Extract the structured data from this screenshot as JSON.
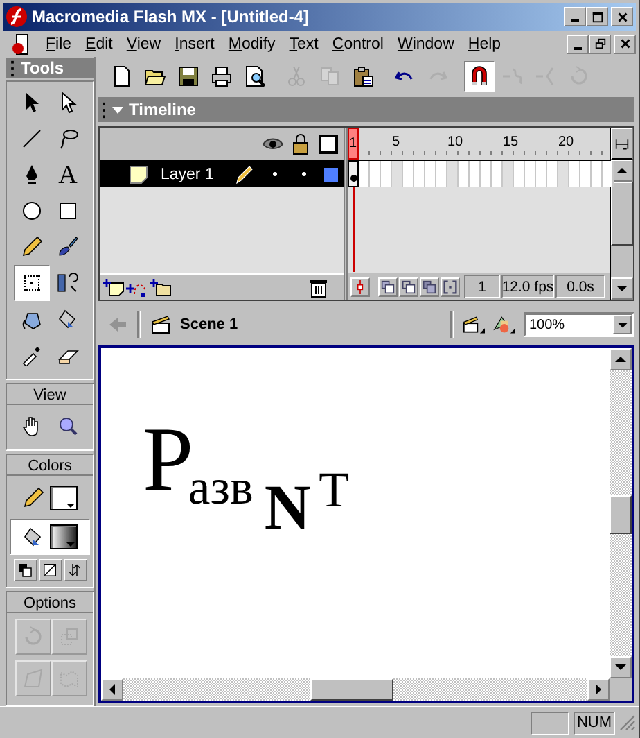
{
  "window": {
    "title": "Macromedia Flash MX - [Untitled-4]"
  },
  "menu": [
    "File",
    "Edit",
    "View",
    "Insert",
    "Modify",
    "Text",
    "Control",
    "Window",
    "Help"
  ],
  "toolbar": [
    {
      "kind": "new",
      "disabled": false,
      "selected": false
    },
    {
      "kind": "open",
      "disabled": false,
      "selected": false
    },
    {
      "kind": "save",
      "disabled": false,
      "selected": false
    },
    {
      "kind": "print",
      "disabled": false,
      "selected": false
    },
    {
      "kind": "preview",
      "disabled": false,
      "selected": false
    },
    {
      "kind": "cut",
      "disabled": true,
      "selected": false
    },
    {
      "kind": "copy",
      "disabled": true,
      "selected": false
    },
    {
      "kind": "paste",
      "disabled": false,
      "selected": false
    },
    {
      "kind": "undo",
      "disabled": false,
      "selected": false
    },
    {
      "kind": "redo",
      "disabled": true,
      "selected": false
    },
    {
      "kind": "snap",
      "disabled": false,
      "selected": true
    },
    {
      "kind": "smooth",
      "disabled": true,
      "selected": false
    },
    {
      "kind": "straighten",
      "disabled": true,
      "selected": false
    },
    {
      "kind": "rotate",
      "disabled": true,
      "selected": false
    }
  ],
  "tools_panel": {
    "title": "Tools",
    "tools": [
      {
        "kind": "arrow",
        "selected": false
      },
      {
        "kind": "subselect",
        "selected": false
      },
      {
        "kind": "line",
        "selected": false
      },
      {
        "kind": "lasso",
        "selected": false
      },
      {
        "kind": "pen",
        "selected": false
      },
      {
        "kind": "text",
        "glyph": "A",
        "selected": false
      },
      {
        "kind": "oval",
        "selected": false
      },
      {
        "kind": "rectangle",
        "selected": false
      },
      {
        "kind": "pencil",
        "selected": false
      },
      {
        "kind": "brush",
        "selected": false
      },
      {
        "kind": "free-transform",
        "selected": true
      },
      {
        "kind": "fill-transform",
        "selected": false
      },
      {
        "kind": "ink-bottle",
        "selected": false
      },
      {
        "kind": "paint-bucket",
        "selected": false
      },
      {
        "kind": "eyedropper",
        "selected": false
      },
      {
        "kind": "eraser",
        "selected": false
      }
    ],
    "view_label": "View",
    "view_tools": [
      {
        "kind": "hand",
        "selected": false
      },
      {
        "kind": "zoom",
        "selected": false
      }
    ],
    "colors_label": "Colors",
    "colors": [
      {
        "kind": "stroke",
        "selected": false
      },
      {
        "kind": "fill",
        "selected": true
      }
    ],
    "color_buttons": [
      {
        "kind": "black-white"
      },
      {
        "kind": "no-color"
      },
      {
        "kind": "swap"
      }
    ],
    "options_label": "Options",
    "options": [
      {
        "kind": "rotate",
        "disabled": true
      },
      {
        "kind": "scale",
        "disabled": true
      },
      {
        "kind": "distort",
        "disabled": true
      },
      {
        "kind": "envelope",
        "disabled": true
      }
    ]
  },
  "timeline": {
    "title": "Timeline",
    "expanded": true,
    "frame_numbers": [
      "1",
      "5",
      "10",
      "15",
      "20"
    ],
    "layers": [
      {
        "name": "Layer 1",
        "selected": true,
        "color": "#4f7fff"
      }
    ],
    "current_frame": "1",
    "frame_rate": "12.0 fps",
    "elapsed_time": "0.0s"
  },
  "scene_bar": {
    "scene": "Scene 1",
    "zoom": "100%"
  },
  "stage": {
    "text": [
      {
        "kind": "large",
        "text": "Р"
      },
      {
        "kind": "small",
        "text": "азв"
      },
      {
        "kind": "bold",
        "text": "N"
      },
      {
        "kind": "raised",
        "text": "Т"
      }
    ]
  },
  "status_bar": {
    "num_lock": "NUM"
  }
}
